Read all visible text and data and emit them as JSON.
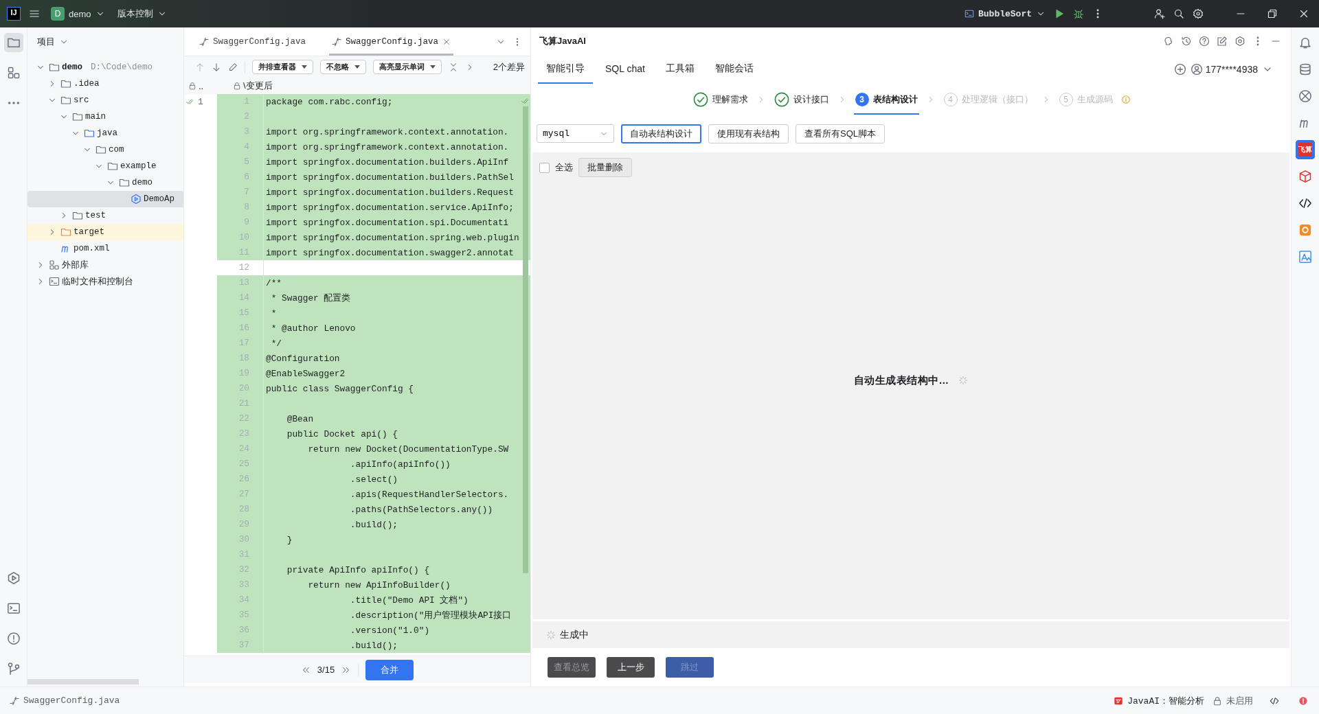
{
  "top_bar": {
    "logo": "IJ",
    "project": {
      "badge": "D",
      "name": "demo"
    },
    "vcs_menu": "版本控制",
    "run_config": "BubbleSort"
  },
  "tool_windows": [
    {
      "kind": "project",
      "selected": true
    },
    {
      "kind": "structure",
      "selected": false
    },
    {
      "kind": "more",
      "selected": false
    }
  ],
  "project_panel": {
    "title": "项目",
    "tree": [
      {
        "label": "demo",
        "path": "D:\\Code\\demo",
        "kind": "module",
        "expanded": true,
        "selected": false,
        "highlighted": false,
        "children": [
          {
            "label": ".idea",
            "kind": "folder",
            "expanded": false,
            "selected": false,
            "highlighted": false
          },
          {
            "label": "src",
            "kind": "folder",
            "expanded": true,
            "selected": false,
            "highlighted": false,
            "children": [
              {
                "label": "main",
                "kind": "folder",
                "expanded": true,
                "selected": false,
                "highlighted": false,
                "children": [
                  {
                    "label": "java",
                    "kind": "source",
                    "expanded": true,
                    "selected": false,
                    "highlighted": false,
                    "children": [
                      {
                        "label": "com",
                        "kind": "package",
                        "expanded": true,
                        "selected": false,
                        "highlighted": false,
                        "children": [
                          {
                            "label": "example",
                            "kind": "package",
                            "expanded": true,
                            "selected": false,
                            "highlighted": false,
                            "children": [
                              {
                                "label": "demo",
                                "kind": "package",
                                "expanded": true,
                                "selected": false,
                                "highlighted": false,
                                "children": [
                                  {
                                    "label": "DemoAp",
                                    "kind": "class",
                                    "selected": true,
                                    "highlighted": false
                                  }
                                ]
                              }
                            ]
                          }
                        ]
                      }
                    ]
                  }
                ]
              },
              {
                "label": "test",
                "kind": "folder",
                "expanded": false,
                "selected": false,
                "highlighted": false
              }
            ]
          },
          {
            "label": "target",
            "kind": "excluded",
            "expanded": false,
            "selected": false,
            "highlighted": true
          },
          {
            "label": "pom.xml",
            "kind": "maven",
            "selected": false,
            "highlighted": false
          }
        ]
      },
      {
        "label": "外部库",
        "kind": "library",
        "expanded": false,
        "selected": false,
        "highlighted": false
      },
      {
        "label": "临时文件和控制台",
        "kind": "scratch",
        "expanded": false,
        "selected": false,
        "highlighted": false
      }
    ]
  },
  "editor": {
    "tabs": [
      {
        "label": "SwaggerConfig.java",
        "selected": false
      },
      {
        "label": "SwaggerConfig.java",
        "selected": true
      }
    ],
    "dropdowns": [
      "并排查看器",
      "不忽略",
      "高亮显示单词"
    ],
    "diff_count": "2个差异",
    "left_path": "..",
    "right_path": "\\变更后",
    "left_line": "1",
    "lines": [
      {
        "number": "1",
        "code": "package com.rabc.config;",
        "changed": true
      },
      {
        "number": "2",
        "changed": true
      },
      {
        "number": "3",
        "code": "import org.springframework.context.annotation.",
        "changed": true
      },
      {
        "number": "4",
        "code": "import org.springframework.context.annotation.",
        "changed": true
      },
      {
        "number": "5",
        "code": "import springfox.documentation.builders.ApiInf",
        "changed": true
      },
      {
        "number": "6",
        "code": "import springfox.documentation.builders.PathSel",
        "changed": true
      },
      {
        "number": "7",
        "code": "import springfox.documentation.builders.Request",
        "changed": true
      },
      {
        "number": "8",
        "code": "import springfox.documentation.service.ApiInfo;",
        "changed": true
      },
      {
        "number": "9",
        "code": "import springfox.documentation.spi.Documentati",
        "changed": true
      },
      {
        "number": "10",
        "code": "import springfox.documentation.spring.web.plugin",
        "changed": true
      },
      {
        "number": "11",
        "code": "import springfox.documentation.swagger2.annotat",
        "changed": true
      },
      {
        "number": "12",
        "changed": false
      },
      {
        "number": "13",
        "code": "/**",
        "changed": true
      },
      {
        "number": "14",
        "code": " * Swagger 配置类",
        "changed": true
      },
      {
        "number": "15",
        "code": " *",
        "changed": true
      },
      {
        "number": "16",
        "code": " * @author Lenovo",
        "changed": true
      },
      {
        "number": "17",
        "code": " */",
        "changed": true
      },
      {
        "number": "18",
        "code": "@Configuration",
        "changed": true
      },
      {
        "number": "19",
        "code": "@EnableSwagger2",
        "changed": true
      },
      {
        "number": "20",
        "code": "public class SwaggerConfig {",
        "changed": true
      },
      {
        "number": "21",
        "changed": true
      },
      {
        "number": "22",
        "code": "    @Bean",
        "changed": true
      },
      {
        "number": "23",
        "code": "    public Docket api() {",
        "changed": true
      },
      {
        "number": "24",
        "code": "        return new Docket(DocumentationType.SW",
        "changed": true
      },
      {
        "number": "25",
        "code": "                .apiInfo(apiInfo())",
        "changed": true
      },
      {
        "number": "26",
        "code": "                .select()",
        "changed": true
      },
      {
        "number": "27",
        "code": "                .apis(RequestHandlerSelectors.",
        "changed": true
      },
      {
        "number": "28",
        "code": "                .paths(PathSelectors.any())",
        "changed": true
      },
      {
        "number": "29",
        "code": "                .build();",
        "changed": true
      },
      {
        "number": "30",
        "code": "    }",
        "changed": true
      },
      {
        "number": "31",
        "changed": true
      },
      {
        "number": "32",
        "code": "    private ApiInfo apiInfo() {",
        "changed": true
      },
      {
        "number": "33",
        "code": "        return new ApiInfoBuilder()",
        "changed": true
      },
      {
        "number": "34",
        "code": "                .title(\"Demo API 文档\")",
        "changed": true
      },
      {
        "number": "35",
        "code": "                .description(\"用户管理模块API接口",
        "changed": true
      },
      {
        "number": "36",
        "code": "                .version(\"1.0\")",
        "changed": true
      },
      {
        "number": "37",
        "code": "                .build();",
        "changed": true
      }
    ],
    "position": "3/15",
    "merge_button": "合并"
  },
  "ai_panel": {
    "title": "飞算JavaAI",
    "tabs": [
      {
        "label": "智能引导",
        "selected": true
      },
      {
        "label": "SQL chat",
        "selected": false
      },
      {
        "label": "工具箱",
        "selected": false
      },
      {
        "label": "智能会话",
        "selected": false
      }
    ],
    "account": "177****4938",
    "steps": [
      {
        "label": "理解需求",
        "completed": true,
        "selected": false
      },
      {
        "label": "设计接口",
        "completed": true,
        "selected": false
      },
      {
        "number": "3",
        "label": "表结构设计",
        "completed": false,
        "selected": true
      },
      {
        "number": "4",
        "label": "处理逻辑（接口）",
        "completed": false,
        "selected": false
      },
      {
        "number": "5",
        "label": "生成源码",
        "completed": false,
        "selected": false
      }
    ],
    "database": "mysql",
    "actions": [
      {
        "label": "自动表结构设计",
        "selected": true
      },
      {
        "label": "使用现有表结构",
        "selected": false
      },
      {
        "label": "查看所有SQL脚本",
        "selected": false
      }
    ],
    "select_all": {
      "label": "全选",
      "checked": false
    },
    "batch_delete": "批量删除",
    "loading_text": "自动生成表结构中...",
    "progress_text": "生成中",
    "footer_buttons": [
      {
        "label": "查看总览",
        "kind": "secondary",
        "disabled": true
      },
      {
        "label": "上一步",
        "kind": "secondary",
        "disabled": false
      },
      {
        "label": "跳过",
        "kind": "primary",
        "disabled": true
      }
    ]
  },
  "right_strip": {
    "badge": "飞算"
  },
  "status_bar": {
    "file": "SwaggerConfig.java",
    "ai_status": "JavaAI：智能分析",
    "lock_status": "未启用"
  }
}
